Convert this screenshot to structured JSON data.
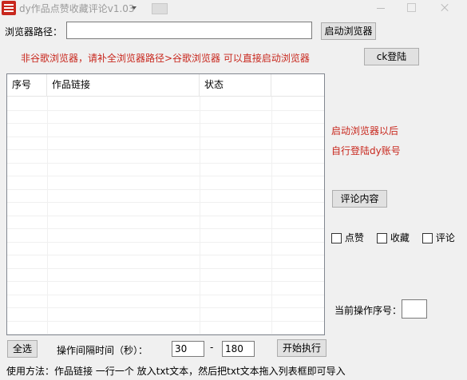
{
  "window": {
    "title": "dy作品点赞收藏评论v1.03"
  },
  "browser": {
    "path_label": "浏览器路径：",
    "path_value": "",
    "start_button": "启动浏览器",
    "warning": "非谷歌浏览器，请补全浏览器路径>谷歌浏览器  可以直接启动浏览器",
    "ck_login_button": "ck登陆"
  },
  "table": {
    "columns": [
      "序号",
      "作品链接",
      "状态"
    ],
    "rows": []
  },
  "side": {
    "hint_line1": "启动浏览器以后",
    "hint_line2": "自行登陆dy账号",
    "comment_button": "评论内容",
    "like_label": "点赞",
    "favorite_label": "收藏",
    "comment_label": "评论",
    "current_index_label": "当前操作序号：",
    "current_index_value": ""
  },
  "bottom": {
    "select_all_button": "全选",
    "interval_label": "操作间隔时间（秒）：",
    "interval_min": "30",
    "interval_sep": "-",
    "interval_max": "180",
    "start_button": "开始执行",
    "usage": "使用方法：作品链接 一行一个 放入txt文本，然后把txt文本拖入列表框即可导入"
  },
  "colors": {
    "warning_red": "#c8281e",
    "window_bg": "#f0f0f0"
  }
}
